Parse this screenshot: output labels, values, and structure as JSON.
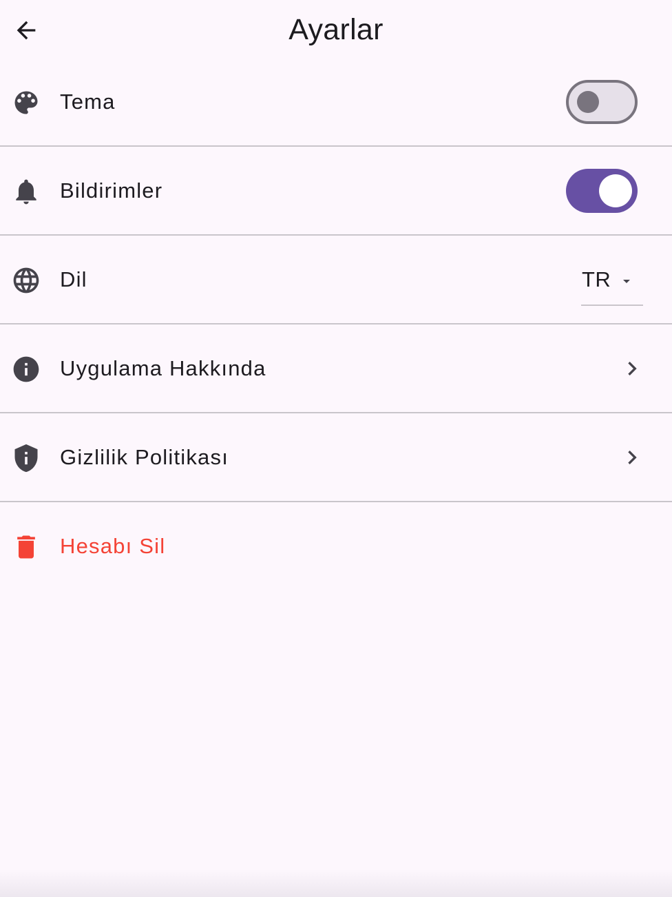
{
  "app_bar": {
    "title": "Ayarlar",
    "back_icon": "arrow-back-icon"
  },
  "settings": {
    "theme": {
      "label": "Tema",
      "icon": "palette-icon",
      "enabled": false
    },
    "notifications": {
      "label": "Bildirimler",
      "icon": "bell-icon",
      "enabled": true
    },
    "language": {
      "label": "Dil",
      "icon": "globe-icon",
      "value": "TR"
    },
    "about": {
      "label": "Uygulama Hakkında",
      "icon": "info-icon"
    },
    "privacy": {
      "label": "Gizlilik Politikası",
      "icon": "shield-info-icon"
    },
    "delete_account": {
      "label": "Hesabı Sil",
      "icon": "trash-icon"
    }
  },
  "colors": {
    "background": "#fdf7fd",
    "primary": "#6750a4",
    "danger": "#f44336",
    "divider": "#c9c5cb",
    "icon": "#45434b"
  }
}
